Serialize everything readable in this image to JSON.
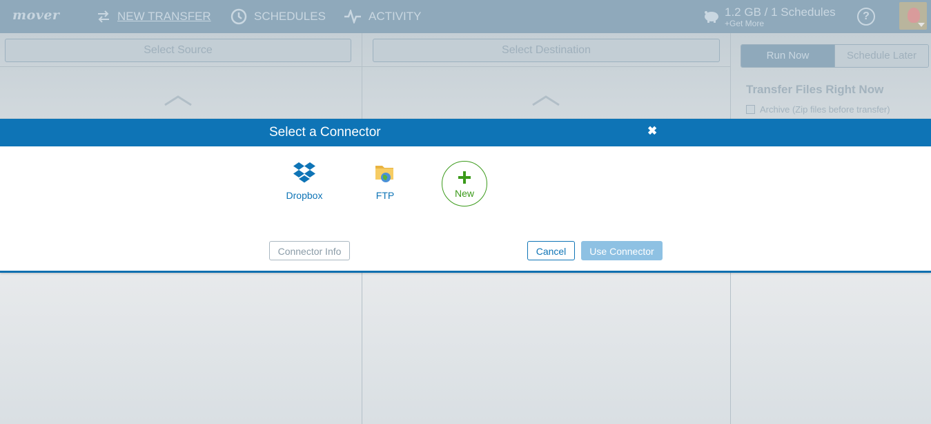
{
  "app": {
    "logo": "mover"
  },
  "nav": {
    "new_transfer": "NEW TRANSFER",
    "schedules": "SCHEDULES",
    "activity": "ACTIVITY"
  },
  "account": {
    "usage": "1.2 GB / 1 Schedules",
    "get_more": "+Get More",
    "help": "?"
  },
  "panels": {
    "source_placeholder": "Select Source",
    "destination_placeholder": "Select Destination"
  },
  "right_panel": {
    "run_now": "Run Now",
    "schedule_later": "Schedule Later",
    "title": "Transfer Files Right Now",
    "archive_label": "Archive (Zip files before transfer)"
  },
  "modal": {
    "title": "Select a Connector",
    "close": "✖",
    "connectors": [
      {
        "label": "Dropbox",
        "icon": "dropbox-icon"
      },
      {
        "label": "FTP",
        "icon": "ftp-folder-icon"
      },
      {
        "label": "New",
        "icon": "plus-icon"
      }
    ],
    "buttons": {
      "info": "Connector Info",
      "cancel": "Cancel",
      "use": "Use Connector"
    }
  },
  "colors": {
    "brand_blue": "#0e74b6",
    "new_green": "#3b9a1a",
    "disabled_blue": "#8ec1e3",
    "dim_topbar": "#8fa9bb"
  }
}
